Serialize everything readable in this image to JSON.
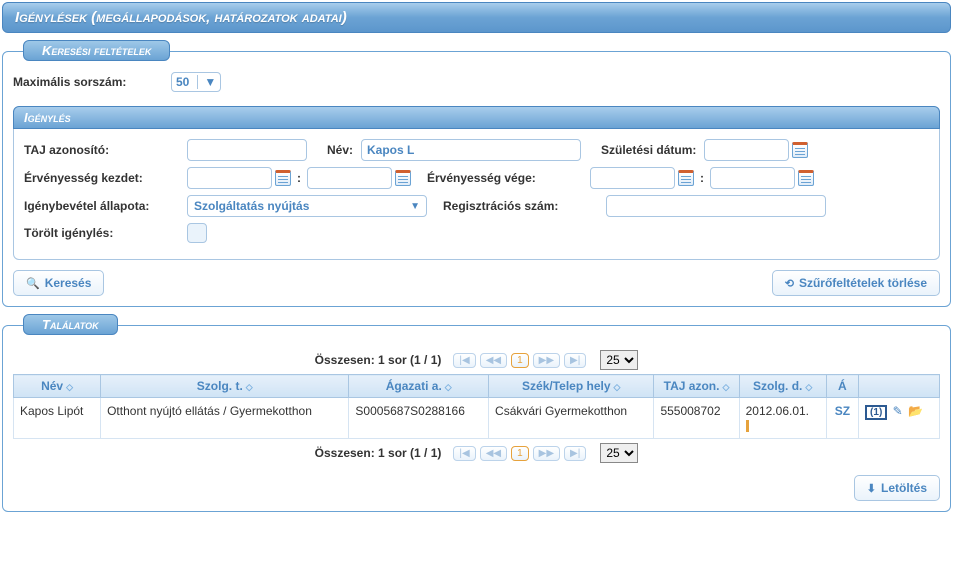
{
  "header": {
    "title": "Igénylések (megállapodások, határozatok adatai)"
  },
  "search": {
    "legend": "Keresési feltételek",
    "max_rows_label": "Maximális sorszám:",
    "max_rows_value": "50"
  },
  "igeny": {
    "header": "Igénylés",
    "taj_label": "TAJ azonosító:",
    "taj_value": "",
    "nev_label": "Név:",
    "nev_value": "Kapos L",
    "szul_label": "Születési dátum:",
    "szul_value": "",
    "erv_kezdet_label": "Érvényesség kezdet:",
    "erv_kezdet_date": "",
    "erv_kezdet_time": "",
    "erv_vege_label": "Érvényesség vége:",
    "erv_vege_date": "",
    "erv_vege_time": "",
    "allapot_label": "Igénybevétel állapota:",
    "allapot_value": "Szolgáltatás nyújtás",
    "regszam_label": "Regisztrációs szám:",
    "regszam_value": "",
    "torolt_label": "Törölt igénylés:"
  },
  "buttons": {
    "search": "Keresés",
    "clear": "Szűrőfeltételek törlése",
    "download": "Letöltés"
  },
  "results": {
    "legend": "Találatok",
    "summary": "Összesen: 1 sor (1 / 1)",
    "page_current": "1",
    "page_size": "25",
    "columns": {
      "nev": "Név",
      "szolgt": "Szolg. t.",
      "agazati": "Ágazati a.",
      "szek": "Szék/Telep hely",
      "tajazon": "TAJ azon.",
      "szolgd": "Szolg. d.",
      "a": "Á"
    },
    "rows": [
      {
        "nev": "Kapos Lipót",
        "szolgt": "Otthont nyújtó ellátás / Gyermekotthon",
        "agazati": "S0005687S0288166",
        "szek": "Csákvári Gyermekotthon",
        "tajazon": "555008702",
        "szolgd": "2012.06.01.",
        "a": "SZ",
        "badge": "(1)"
      }
    ]
  }
}
